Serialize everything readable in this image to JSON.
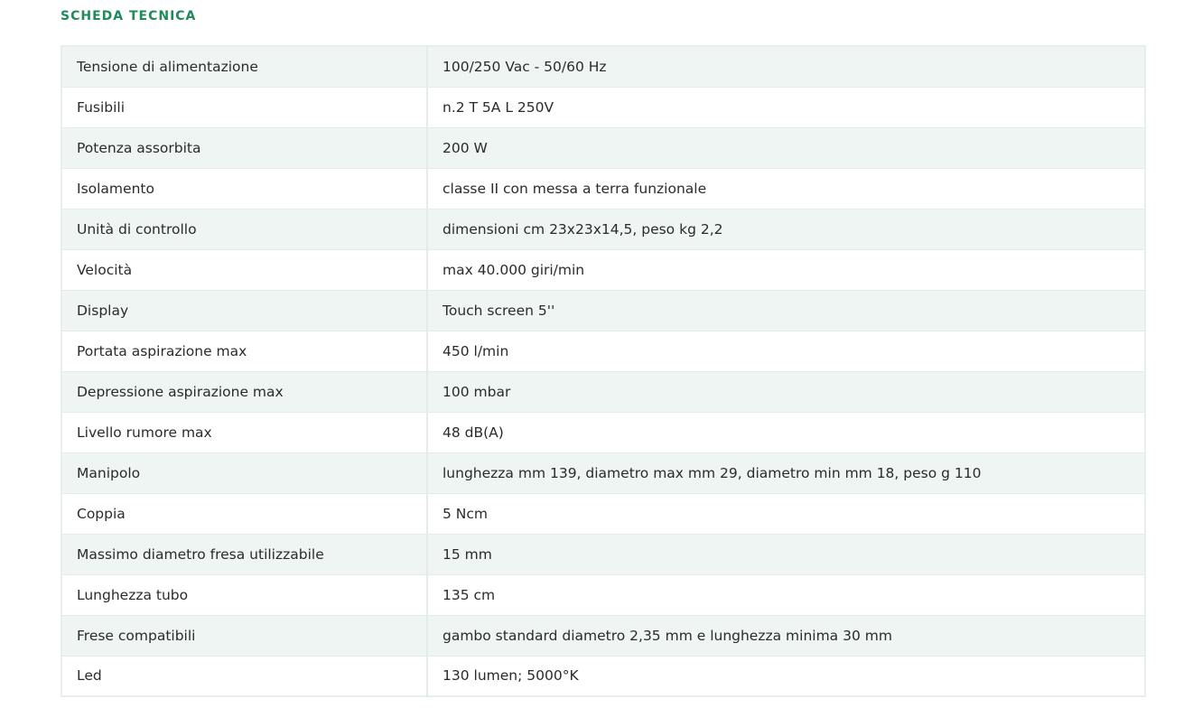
{
  "section": {
    "title": "SCHEDA TECNICA"
  },
  "specs": [
    {
      "label": "Tensione di alimentazione",
      "value": "100/250 Vac - 50/60 Hz"
    },
    {
      "label": "Fusibili",
      "value": "n.2 T 5A L 250V"
    },
    {
      "label": "Potenza assorbita",
      "value": "200 W"
    },
    {
      "label": "Isolamento",
      "value": "classe II con messa a terra funzionale"
    },
    {
      "label": "Unità di controllo",
      "value": "dimensioni cm 23x23x14,5, peso kg 2,2"
    },
    {
      "label": "Velocità",
      "value": "max 40.000 giri/min"
    },
    {
      "label": "Display",
      "value": "Touch screen 5''"
    },
    {
      "label": "Portata aspirazione max",
      "value": "450 l/min"
    },
    {
      "label": "Depressione aspirazione max",
      "value": "100 mbar"
    },
    {
      "label": "Livello rumore max",
      "value": "48 dB(A)"
    },
    {
      "label": "Manipolo",
      "value": "lunghezza mm 139, diametro max mm 29, diametro min mm 18, peso g 110"
    },
    {
      "label": "Coppia",
      "value": "5 Ncm"
    },
    {
      "label": "Massimo diametro fresa utilizzabile",
      "value": "15 mm"
    },
    {
      "label": "Lunghezza tubo",
      "value": "135 cm"
    },
    {
      "label": "Frese compatibili",
      "value": "gambo standard diametro 2,35 mm e lunghezza minima 30 mm"
    },
    {
      "label": "Led",
      "value": "130 lumen; 5000°K"
    }
  ],
  "colors": {
    "title": "#1f8a5b",
    "row_alt": "#eef5f3",
    "border": "#e3ece9"
  }
}
